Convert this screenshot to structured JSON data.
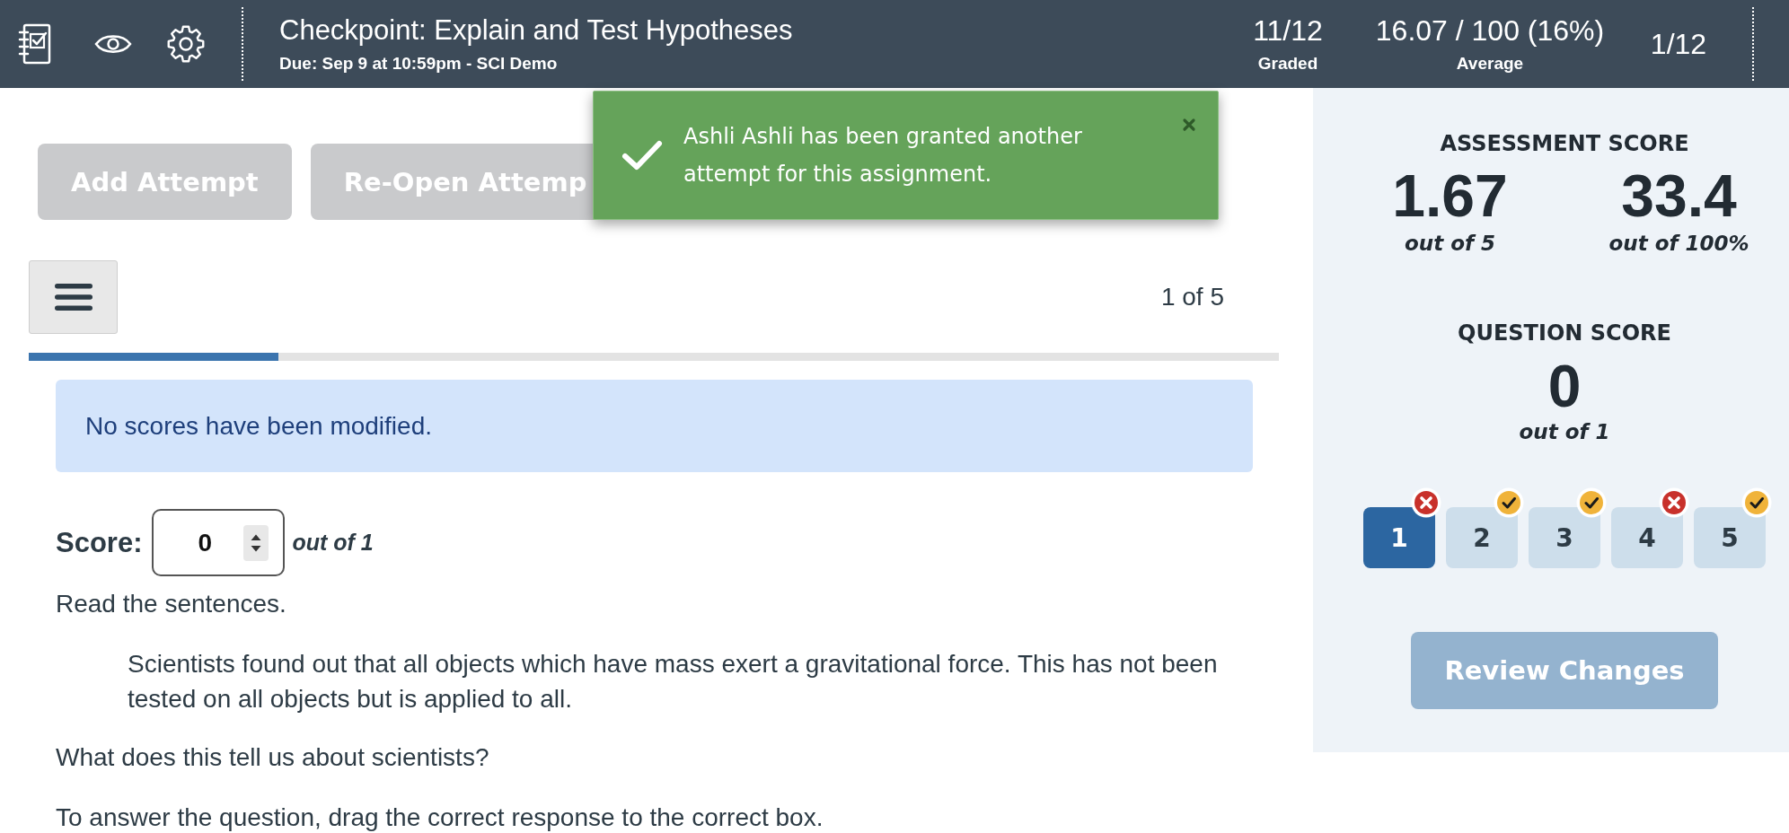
{
  "header": {
    "title": "Checkpoint: Explain and Test Hypotheses",
    "subtitle": "Due: Sep 9 at 10:59pm - SCI Demo",
    "stats": [
      {
        "value": "11/12",
        "label": "Graded"
      },
      {
        "value": "16.07 / 100 (16%)",
        "label": "Average"
      },
      {
        "value": "1/12"
      }
    ]
  },
  "actions": [
    {
      "label": "Add Attempt",
      "disabled": true
    },
    {
      "label": "Re-Open Attemp",
      "disabled": true
    }
  ],
  "toast": {
    "message": "Ashli Ashli has been granted another attempt for this assignment."
  },
  "question_nav": {
    "position": "1 of 5",
    "progress": {
      "level": 0.2
    }
  },
  "alert": {
    "message": "No scores have been modified."
  },
  "score": {
    "label": "Score:",
    "value": "0",
    "suffix": "out of 1"
  },
  "question": {
    "intro": "Read the sentences.",
    "passage": "Scientists found out that all objects which have mass exert a gravitational force. This has not been tested on all objects but is applied to all.",
    "prompt": "What does this tell us about scientists?",
    "instruction": "To answer the question, drag the correct response to the correct box."
  },
  "sidebar": {
    "assessment_score": {
      "title": "ASSESSMENT SCORE",
      "points": "1.67",
      "points_caption": "out of 5",
      "percent": "33.4",
      "percent_caption": "out of 100%"
    },
    "question_score": {
      "title": "QUESTION SCORE",
      "value": "0",
      "caption": "out of 1"
    },
    "questions": [
      {
        "label": "1",
        "selected": true,
        "correct": false
      },
      {
        "label": "2",
        "selected": false,
        "correct": true
      },
      {
        "label": "3",
        "selected": false,
        "correct": true
      },
      {
        "label": "4",
        "selected": false,
        "correct": false
      },
      {
        "label": "5",
        "selected": false,
        "correct": true
      }
    ],
    "review_button": {
      "label": "Review Changes",
      "disabled": true
    }
  }
}
